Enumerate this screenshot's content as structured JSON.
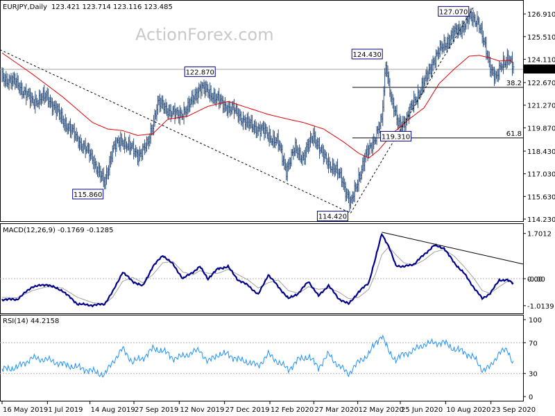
{
  "chart_data": {
    "type": "line",
    "header": {
      "symbol_timeframe": "EURJPY,Daily",
      "ohlc": "123.421 123.714 123.116 123.485"
    },
    "watermark": "ActionForex.com",
    "price_panel": {
      "ylim": [
        114.23,
        127.6
      ],
      "y_ticks": [
        "126.910",
        "125.510",
        "124.110",
        "122.670",
        "121.270",
        "119.870",
        "118.430",
        "117.030",
        "115.630",
        "114.230"
      ],
      "y_tick_values": [
        126.91,
        125.51,
        124.11,
        122.67,
        121.27,
        119.87,
        118.43,
        117.03,
        115.63,
        114.23
      ],
      "current_price_label": "123.485",
      "current_price": 123.485,
      "annotations": [
        {
          "label": "115.860",
          "bar": 102,
          "value": 115.86
        },
        {
          "label": "122.870",
          "bar": 197,
          "value": 122.87
        },
        {
          "label": "114.420",
          "bar": 347,
          "value": 114.42
        },
        {
          "label": "124.430",
          "bar": 380,
          "value": 124.43
        },
        {
          "label": "119.310",
          "bar": 392,
          "value": 119.31
        },
        {
          "label": "127.070",
          "bar": 466,
          "value": 127.07
        }
      ],
      "fib_levels": [
        {
          "label": "38.2",
          "value": 122.37
        },
        {
          "label": "61.8",
          "value": 119.25
        }
      ],
      "close_key": [
        [
          0,
          123.0
        ],
        [
          15,
          122.6
        ],
        [
          30,
          121.5
        ],
        [
          45,
          121.8
        ],
        [
          60,
          120.4
        ],
        [
          75,
          119.2
        ],
        [
          90,
          118.0
        ],
        [
          102,
          116.4
        ],
        [
          110,
          118.6
        ],
        [
          120,
          119.1
        ],
        [
          135,
          118.2
        ],
        [
          145,
          118.8
        ],
        [
          155,
          121.4
        ],
        [
          165,
          121.0
        ],
        [
          175,
          120.6
        ],
        [
          185,
          121.1
        ],
        [
          197,
          122.4
        ],
        [
          210,
          121.9
        ],
        [
          220,
          121.3
        ],
        [
          230,
          121.0
        ],
        [
          245,
          120.1
        ],
        [
          260,
          119.7
        ],
        [
          275,
          118.9
        ],
        [
          283,
          117.3
        ],
        [
          292,
          118.6
        ],
        [
          300,
          118.0
        ],
        [
          310,
          119.5
        ],
        [
          318,
          118.3
        ],
        [
          328,
          117.5
        ],
        [
          338,
          116.8
        ],
        [
          347,
          115.1
        ],
        [
          355,
          116.8
        ],
        [
          362,
          118.1
        ],
        [
          370,
          119.1
        ],
        [
          378,
          120.3
        ],
        [
          382,
          123.9
        ],
        [
          388,
          121.5
        ],
        [
          394,
          120.1
        ],
        [
          402,
          120.3
        ],
        [
          410,
          121.5
        ],
        [
          420,
          122.6
        ],
        [
          430,
          124.1
        ],
        [
          440,
          125.0
        ],
        [
          450,
          125.7
        ],
        [
          460,
          126.2
        ],
        [
          466,
          126.7
        ],
        [
          474,
          126.5
        ],
        [
          480,
          125.0
        ],
        [
          486,
          123.7
        ],
        [
          492,
          122.9
        ],
        [
          498,
          123.8
        ],
        [
          504,
          124.3
        ],
        [
          509,
          123.5
        ]
      ],
      "ma_key": [
        [
          0,
          124.5
        ],
        [
          30,
          123.2
        ],
        [
          60,
          121.8
        ],
        [
          90,
          120.2
        ],
        [
          105,
          119.8
        ],
        [
          120,
          119.7
        ],
        [
          135,
          119.4
        ],
        [
          150,
          119.5
        ],
        [
          165,
          120.4
        ],
        [
          185,
          120.6
        ],
        [
          205,
          121.2
        ],
        [
          225,
          121.5
        ],
        [
          245,
          121.1
        ],
        [
          265,
          120.7
        ],
        [
          285,
          120.4
        ],
        [
          300,
          120.2
        ],
        [
          320,
          119.8
        ],
        [
          340,
          119.0
        ],
        [
          355,
          118.3
        ],
        [
          365,
          118.0
        ],
        [
          375,
          118.5
        ],
        [
          390,
          119.6
        ],
        [
          405,
          120.4
        ],
        [
          420,
          121.1
        ],
        [
          435,
          122.6
        ],
        [
          450,
          123.5
        ],
        [
          465,
          124.3
        ],
        [
          475,
          124.35
        ],
        [
          485,
          124.2
        ],
        [
          495,
          124.0
        ],
        [
          505,
          124.05
        ],
        [
          509,
          123.9
        ]
      ]
    },
    "macd_panel": {
      "label": "MACD(12,26,9) -0.1769 -0.1285",
      "ylim": [
        -1.2,
        1.85
      ],
      "y_ticks": [
        "1.7012",
        "0.00",
        "-1.0139"
      ],
      "y_tick_values": [
        1.7012,
        0.0,
        -1.0139
      ],
      "current_label": "-0.00",
      "main_key": [
        [
          0,
          -0.78
        ],
        [
          15,
          -0.78
        ],
        [
          30,
          -0.3
        ],
        [
          45,
          -0.22
        ],
        [
          60,
          -0.45
        ],
        [
          75,
          -0.95
        ],
        [
          90,
          -1.0
        ],
        [
          102,
          -0.95
        ],
        [
          110,
          -0.5
        ],
        [
          120,
          0.25
        ],
        [
          130,
          -0.1
        ],
        [
          140,
          -0.28
        ],
        [
          150,
          0.45
        ],
        [
          160,
          0.88
        ],
        [
          170,
          0.55
        ],
        [
          180,
          0.0
        ],
        [
          190,
          0.25
        ],
        [
          197,
          0.45
        ],
        [
          205,
          0.0
        ],
        [
          215,
          0.38
        ],
        [
          225,
          0.45
        ],
        [
          235,
          -0.05
        ],
        [
          245,
          -0.25
        ],
        [
          255,
          -0.6
        ],
        [
          265,
          0.15
        ],
        [
          275,
          -0.3
        ],
        [
          285,
          -0.75
        ],
        [
          295,
          -0.55
        ],
        [
          305,
          -0.1
        ],
        [
          315,
          -0.65
        ],
        [
          325,
          -0.25
        ],
        [
          335,
          -0.75
        ],
        [
          345,
          -0.95
        ],
        [
          355,
          -0.5
        ],
        [
          365,
          -0.15
        ],
        [
          372,
          0.8
        ],
        [
          378,
          1.7
        ],
        [
          385,
          1.2
        ],
        [
          392,
          0.5
        ],
        [
          400,
          0.45
        ],
        [
          410,
          0.55
        ],
        [
          420,
          0.9
        ],
        [
          430,
          1.25
        ],
        [
          440,
          1.15
        ],
        [
          450,
          0.6
        ],
        [
          460,
          0.2
        ],
        [
          470,
          -0.35
        ],
        [
          478,
          -0.75
        ],
        [
          486,
          -0.55
        ],
        [
          495,
          -0.05
        ],
        [
          503,
          -0.05
        ],
        [
          509,
          -0.18
        ]
      ],
      "signal_key": [
        [
          0,
          -0.7
        ],
        [
          15,
          -0.72
        ],
        [
          30,
          -0.45
        ],
        [
          45,
          -0.3
        ],
        [
          60,
          -0.35
        ],
        [
          75,
          -0.7
        ],
        [
          90,
          -0.9
        ],
        [
          102,
          -0.95
        ],
        [
          110,
          -0.7
        ],
        [
          120,
          -0.1
        ],
        [
          130,
          0.05
        ],
        [
          140,
          -0.15
        ],
        [
          150,
          0.15
        ],
        [
          160,
          0.6
        ],
        [
          170,
          0.65
        ],
        [
          180,
          0.25
        ],
        [
          190,
          0.15
        ],
        [
          197,
          0.3
        ],
        [
          205,
          0.2
        ],
        [
          215,
          0.2
        ],
        [
          225,
          0.35
        ],
        [
          235,
          0.15
        ],
        [
          245,
          -0.05
        ],
        [
          255,
          -0.35
        ],
        [
          265,
          -0.15
        ],
        [
          275,
          -0.05
        ],
        [
          285,
          -0.45
        ],
        [
          295,
          -0.55
        ],
        [
          305,
          -0.3
        ],
        [
          315,
          -0.4
        ],
        [
          325,
          -0.35
        ],
        [
          335,
          -0.5
        ],
        [
          345,
          -0.75
        ],
        [
          355,
          -0.7
        ],
        [
          365,
          -0.4
        ],
        [
          372,
          0.2
        ],
        [
          378,
          0.9
        ],
        [
          385,
          1.2
        ],
        [
          392,
          0.9
        ],
        [
          400,
          0.6
        ],
        [
          410,
          0.5
        ],
        [
          420,
          0.7
        ],
        [
          430,
          1.0
        ],
        [
          440,
          1.1
        ],
        [
          450,
          0.85
        ],
        [
          460,
          0.45
        ],
        [
          470,
          0.0
        ],
        [
          478,
          -0.45
        ],
        [
          486,
          -0.55
        ],
        [
          495,
          -0.3
        ],
        [
          503,
          -0.1
        ],
        [
          509,
          -0.13
        ]
      ]
    },
    "rsi_panel": {
      "label": "RSI(14) 44.2158",
      "ylim": [
        0,
        100
      ],
      "y_ticks": [
        "100",
        "70",
        "30",
        "0"
      ],
      "y_tick_values": [
        100,
        70,
        30,
        0
      ],
      "levels": [
        70,
        30
      ],
      "key": [
        [
          0,
          35
        ],
        [
          15,
          38
        ],
        [
          30,
          50
        ],
        [
          45,
          48
        ],
        [
          60,
          42
        ],
        [
          75,
          38
        ],
        [
          90,
          33
        ],
        [
          102,
          28
        ],
        [
          110,
          45
        ],
        [
          120,
          62
        ],
        [
          130,
          45
        ],
        [
          140,
          50
        ],
        [
          150,
          62
        ],
        [
          160,
          60
        ],
        [
          170,
          50
        ],
        [
          180,
          52
        ],
        [
          190,
          58
        ],
        [
          197,
          60
        ],
        [
          205,
          45
        ],
        [
          215,
          55
        ],
        [
          225,
          55
        ],
        [
          235,
          48
        ],
        [
          245,
          45
        ],
        [
          255,
          40
        ],
        [
          265,
          55
        ],
        [
          275,
          45
        ],
        [
          285,
          35
        ],
        [
          295,
          48
        ],
        [
          305,
          52
        ],
        [
          315,
          38
        ],
        [
          325,
          55
        ],
        [
          335,
          40
        ],
        [
          345,
          30
        ],
        [
          355,
          45
        ],
        [
          365,
          55
        ],
        [
          372,
          70
        ],
        [
          378,
          80
        ],
        [
          385,
          58
        ],
        [
          392,
          48
        ],
        [
          400,
          55
        ],
        [
          410,
          60
        ],
        [
          420,
          68
        ],
        [
          430,
          70
        ],
        [
          440,
          70
        ],
        [
          450,
          62
        ],
        [
          460,
          58
        ],
        [
          470,
          50
        ],
        [
          478,
          35
        ],
        [
          486,
          38
        ],
        [
          495,
          58
        ],
        [
          503,
          60
        ],
        [
          509,
          44
        ]
      ]
    },
    "x_axis": {
      "bar_count": 510,
      "labels": [
        {
          "label": "16 May 2019",
          "bar": 0
        },
        {
          "label": "1 Jul 2019",
          "bar": 33
        },
        {
          "label": "14 Aug 2019",
          "bar": 64
        },
        {
          "label": "27 Sep 2019",
          "bar": 96
        },
        {
          "label": "12 Nov 2019",
          "bar": 129
        },
        {
          "label": "27 Dec 2019",
          "bar": 162
        },
        {
          "label": "12 Feb 2020",
          "bar": 195
        },
        {
          "label": "27 Mar 2020",
          "bar": 227
        },
        {
          "label": "12 May 2020",
          "bar": 259
        },
        {
          "label": "25 Jun 2020",
          "bar": 290
        },
        {
          "label": "10 Aug 2020",
          "bar": 323
        },
        {
          "label": "23 Sep 2020",
          "bar": 356
        }
      ]
    },
    "colors": {
      "price": "#2c4f7c",
      "ma": "#e00000",
      "macd": "#00008b",
      "signal": "#a0a0a0",
      "rsi": "#1e90ff",
      "trendline": "#000000",
      "label_border": "#000080"
    }
  }
}
